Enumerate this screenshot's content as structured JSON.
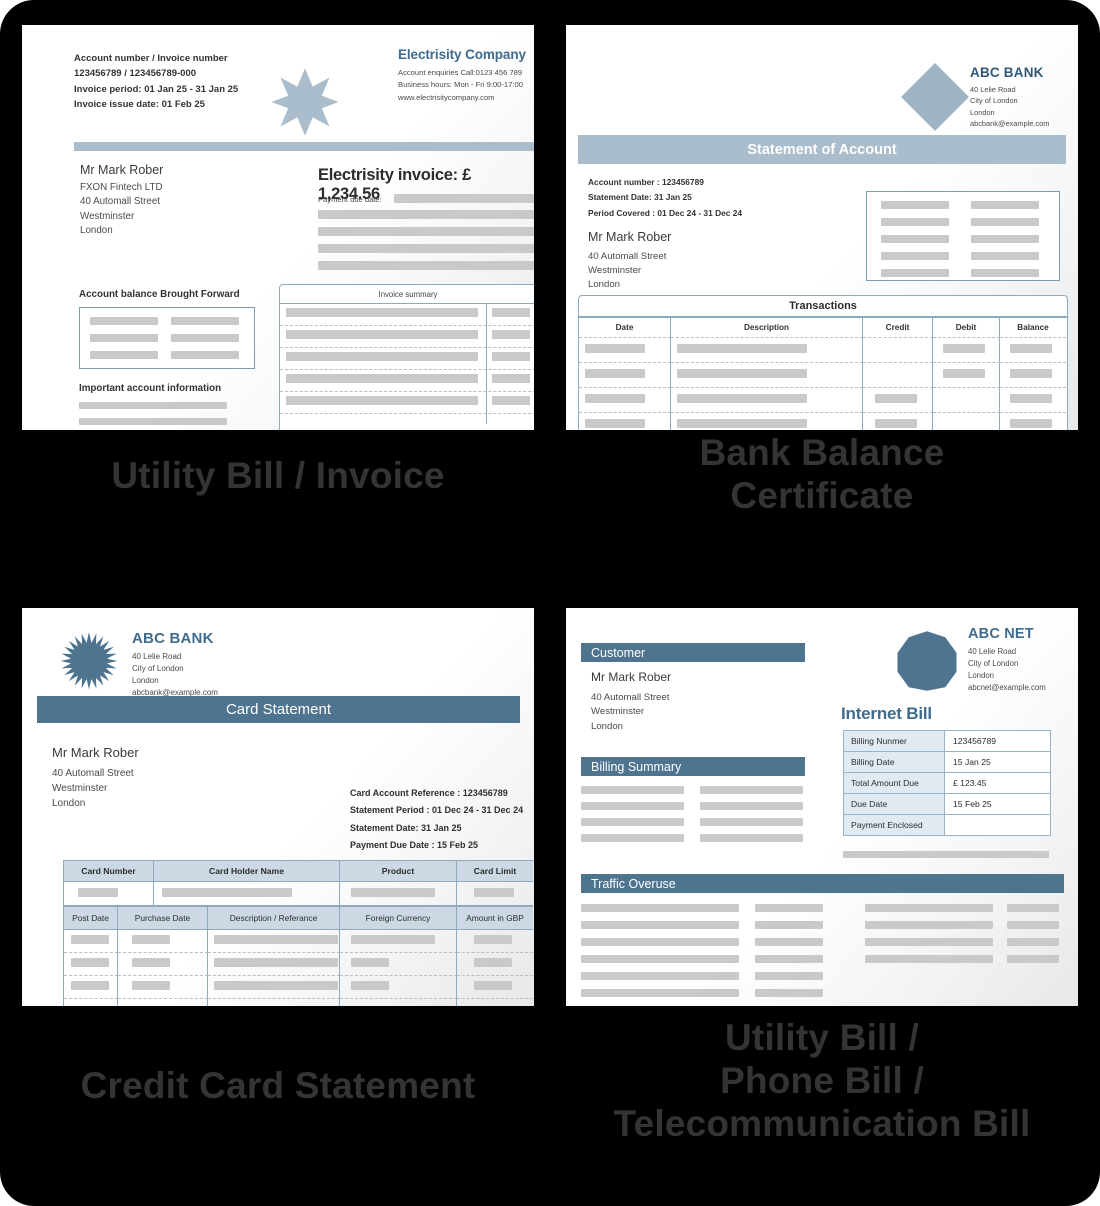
{
  "page": {
    "background": "#000000",
    "accent_blue": "#4e7490",
    "accent_light": "#a9bdcd",
    "caption_color": "#343434",
    "placeholder_gray": "#c9c9c9"
  },
  "captions": {
    "doc1": "Utility Bill / Invoice",
    "doc2": "Bank Balance\nCertificate",
    "doc3": "Credit Card Statement",
    "doc4": "Utility Bill /\nPhone Bill /\nTelecommunication Bill"
  },
  "doc1": {
    "header_lines": [
      "Account number / Invoice number",
      "123456789 / 123456789-000",
      "Invoice period: 01 Jan 25 - 31 Jan 25",
      "Invoice issue date: 01 Feb 25"
    ],
    "company": {
      "name": "Electrisity Company",
      "lines": [
        "Account enquiries Call:0123 456 789",
        "Business hours: Mon - Fri 9:00-17:00",
        "www.electrisitycompany.com"
      ]
    },
    "customer": {
      "name": "Mr  Mark Rober",
      "address": [
        "FXON Fintech LTD",
        "40 Automall Street",
        "Westminster",
        "London"
      ]
    },
    "invoice_total_label": "Electrisity invoice: £ 1,234.56",
    "payment_due_label": "Payment due date:",
    "section_balance": "Account balance Brought Forward",
    "section_important": "Important account information",
    "summary_caption": "Invoice summary",
    "summary_rows": 5
  },
  "doc2": {
    "company": {
      "name": "ABC BANK",
      "lines": [
        "40 Lelie Road",
        "City of London",
        "London",
        "abcbank@example.com"
      ]
    },
    "title": "Statement of Account",
    "meta": [
      "Account number : 123456789",
      "Statement Date:  31 Jan 25",
      "Period Covered : 01 Dec 24 - 31 Dec 24"
    ],
    "customer": {
      "name": "Mr Mark Rober",
      "address": [
        "40 Automall Street",
        "Westminster",
        "London"
      ]
    },
    "table": {
      "caption": "Transactions",
      "columns": [
        "Date",
        "Description",
        "Credit",
        "Debit",
        "Balance"
      ],
      "rows": [
        {
          "date": true,
          "description": true,
          "credit": false,
          "debit": true,
          "balance": true
        },
        {
          "date": true,
          "description": true,
          "credit": false,
          "debit": true,
          "balance": true
        },
        {
          "date": true,
          "description": true,
          "credit": true,
          "debit": false,
          "balance": true
        },
        {
          "date": true,
          "description": true,
          "credit": true,
          "debit": false,
          "balance": true
        },
        {
          "date": false,
          "description": true,
          "credit": false,
          "debit": false,
          "balance": false
        }
      ]
    }
  },
  "doc3": {
    "company": {
      "name": "ABC BANK",
      "lines": [
        "40 Lelie Road",
        "City of London",
        "London",
        "abcbank@example.com"
      ]
    },
    "title": "Card Statement",
    "customer": {
      "name": "Mr Mark Rober",
      "address": [
        "40 Automall Street",
        "Westminster",
        "London"
      ]
    },
    "meta": [
      "Card Account Reference : 123456789",
      "Statement Period : 01 Dec 24 - 31 Dec 24",
      "Statement Date:  31 Jan 25",
      "Payment Due Date : 15 Feb 25"
    ],
    "card_columns": [
      "Card Number",
      "Card Holder Name",
      "Product",
      "Card Limit"
    ],
    "txn_columns": [
      "Post Date",
      "Purchase Date",
      "Description / Referance",
      "Foreign Currency",
      "Amount in GBP"
    ],
    "txn_rows": 4
  },
  "doc4": {
    "company": {
      "name": "ABC NET",
      "lines": [
        "40 Lelie Road",
        "City of London",
        "London",
        "abcnet@example.com"
      ]
    },
    "sections": {
      "customer": "Customer",
      "billing_summary": "Billing Summary",
      "traffic_overuse": "Traffic Overuse"
    },
    "customer": {
      "name": "Mr Mark Rober",
      "address": [
        "40 Automall Street",
        "Westminster",
        "London"
      ]
    },
    "bill_title": "Internet Bill",
    "bill_table": [
      {
        "key": "Billing Nunmer",
        "value": "123456789"
      },
      {
        "key": "Billing Date",
        "value": "15 Jan 25"
      },
      {
        "key": "Total Amount Due",
        "value": "£ 123.45"
      },
      {
        "key": "Due Date",
        "value": "15 Feb 25"
      },
      {
        "key": "Payment Enclosed",
        "value": ""
      }
    ]
  }
}
